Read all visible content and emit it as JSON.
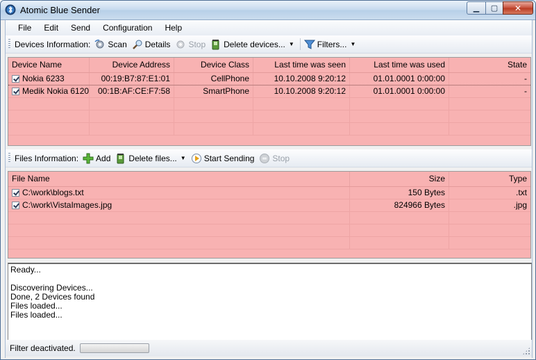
{
  "window": {
    "title": "Atomic Blue Sender"
  },
  "menu": [
    "File",
    "Edit",
    "Send",
    "Configuration",
    "Help"
  ],
  "devices_toolbar": {
    "label": "Devices Information:",
    "scan": "Scan",
    "details": "Details",
    "stop": "Stop",
    "delete": "Delete devices...",
    "filters": "Filters..."
  },
  "devices_table": {
    "columns": [
      "Device Name",
      "Device Address",
      "Device Class",
      "Last time was seen",
      "Last time was used",
      "State"
    ],
    "rows": [
      {
        "name": "Nokia 6233",
        "address": "00:19:B7:87:E1:01",
        "class": "CellPhone",
        "seen": "10.10.2008 9:20:12",
        "used": "01.01.0001 0:00:00",
        "state": "-",
        "checked": true
      },
      {
        "name": "Medik Nokia 6120",
        "address": "00:1B:AF:CE:F7:58",
        "class": "SmartPhone",
        "seen": "10.10.2008 9:20:12",
        "used": "01.01.0001 0:00:00",
        "state": "-",
        "checked": true
      }
    ]
  },
  "files_toolbar": {
    "label": "Files Information:",
    "add": "Add",
    "delete": "Delete files...",
    "start": "Start Sending",
    "stop": "Stop"
  },
  "files_table": {
    "columns": [
      "File Name",
      "Size",
      "Type"
    ],
    "rows": [
      {
        "name": "C:\\work\\blogs.txt",
        "size": "150 Bytes",
        "type": ".txt",
        "checked": true
      },
      {
        "name": "C:\\work\\VistaImages.jpg",
        "size": "824966 Bytes",
        "type": ".jpg",
        "checked": true
      }
    ]
  },
  "log": [
    "Ready...",
    "",
    "Discovering Devices...",
    "Done, 2 Devices found",
    "Files loaded...",
    "Files loaded..."
  ],
  "status": {
    "text": "Filter deactivated.",
    "progress": 0
  },
  "colors": {
    "grid_bg": "#f8b2b2",
    "title_close": "#c7503b"
  }
}
